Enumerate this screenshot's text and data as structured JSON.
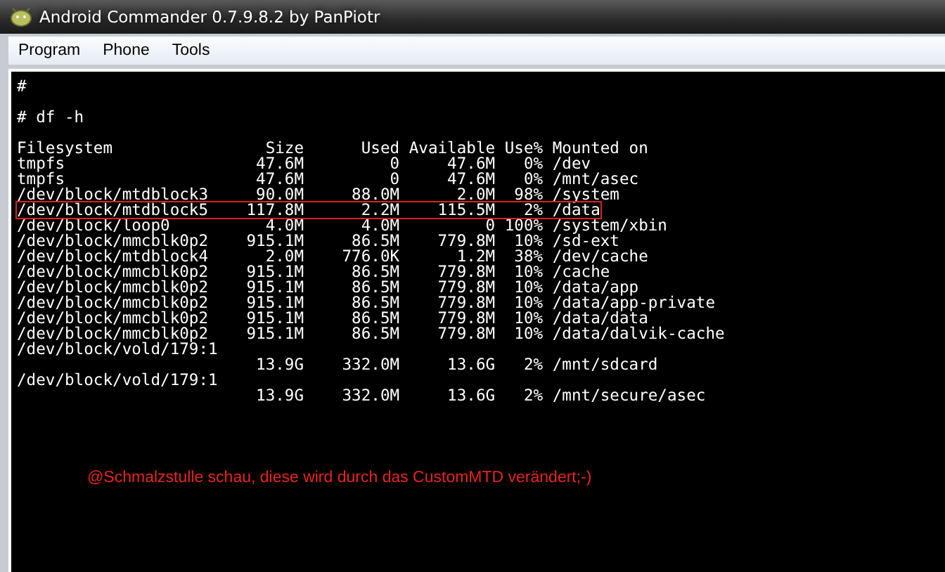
{
  "window": {
    "title": "Android Commander 0.7.9.8.2 by PanPiotr"
  },
  "menu": [
    "Program",
    "Phone",
    "Tools"
  ],
  "terminal": {
    "blocks": [
      [
        {
          "text": "#",
          "highlighted": false
        }
      ],
      [
        {
          "text": "# df -h",
          "highlighted": false
        }
      ],
      [
        {
          "text": "Filesystem                Size      Used Available Use% Mounted on",
          "highlighted": false
        },
        {
          "text": "tmpfs                    47.6M         0     47.6M   0% /dev",
          "highlighted": false
        },
        {
          "text": "tmpfs                    47.6M         0     47.6M   0% /mnt/asec",
          "highlighted": false
        },
        {
          "text": "/dev/block/mtdblock3     90.0M     88.0M      2.0M  98% /system",
          "highlighted": false
        },
        {
          "text": "/dev/block/mtdblock5    117.8M      2.2M    115.5M   2% /data",
          "highlighted": true
        },
        {
          "text": "/dev/block/loop0          4.0M      4.0M         0 100% /system/xbin",
          "highlighted": false
        },
        {
          "text": "/dev/block/mmcblk0p2    915.1M     86.5M    779.8M  10% /sd-ext",
          "highlighted": false
        },
        {
          "text": "/dev/block/mtdblock4      2.0M    776.0K      1.2M  38% /dev/cache",
          "highlighted": false
        },
        {
          "text": "/dev/block/mmcblk0p2    915.1M     86.5M    779.8M  10% /cache",
          "highlighted": false
        },
        {
          "text": "/dev/block/mmcblk0p2    915.1M     86.5M    779.8M  10% /data/app",
          "highlighted": false
        },
        {
          "text": "/dev/block/mmcblk0p2    915.1M     86.5M    779.8M  10% /data/app-private",
          "highlighted": false
        },
        {
          "text": "/dev/block/mmcblk0p2    915.1M     86.5M    779.8M  10% /data/data",
          "highlighted": false
        },
        {
          "text": "/dev/block/mmcblk0p2    915.1M     86.5M    779.8M  10% /data/dalvik-cache",
          "highlighted": false
        },
        {
          "text": "/dev/block/vold/179:1",
          "highlighted": false
        },
        {
          "text": "                         13.9G    332.0M     13.6G   2% /mnt/sdcard",
          "highlighted": false
        },
        {
          "text": "/dev/block/vold/179:1",
          "highlighted": false
        },
        {
          "text": "                         13.9G    332.0M     13.6G   2% /mnt/secure/asec",
          "highlighted": false
        }
      ]
    ]
  },
  "annotation": "@Schmalzstulle schau, diese wird durch das CustomMTD verändert;-)"
}
